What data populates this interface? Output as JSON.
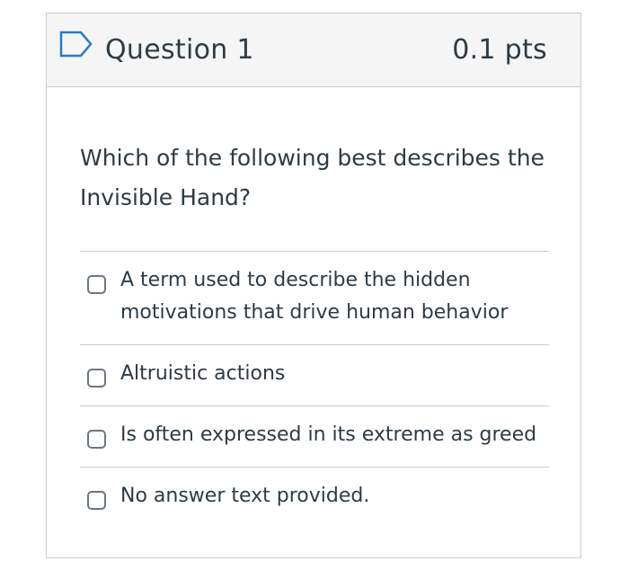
{
  "question": {
    "title": "Question 1",
    "points": "0.1 pts",
    "flag_icon": "bookmark-flag-icon",
    "prompt": "Which of the following best describes the Invisible Hand?",
    "answers": [
      {
        "label": "A term used to describe the hidden motivations that drive human behavior",
        "selected": false
      },
      {
        "label": "Altruistic actions",
        "selected": false
      },
      {
        "label": "Is often expressed in its extreme as greed",
        "selected": false
      },
      {
        "label": "No answer text provided.",
        "selected": false
      }
    ]
  },
  "colors": {
    "text": "#2d3b45",
    "header_bg": "#f5f5f5",
    "border": "#c7cdd1",
    "flag": "#2b78c6"
  }
}
